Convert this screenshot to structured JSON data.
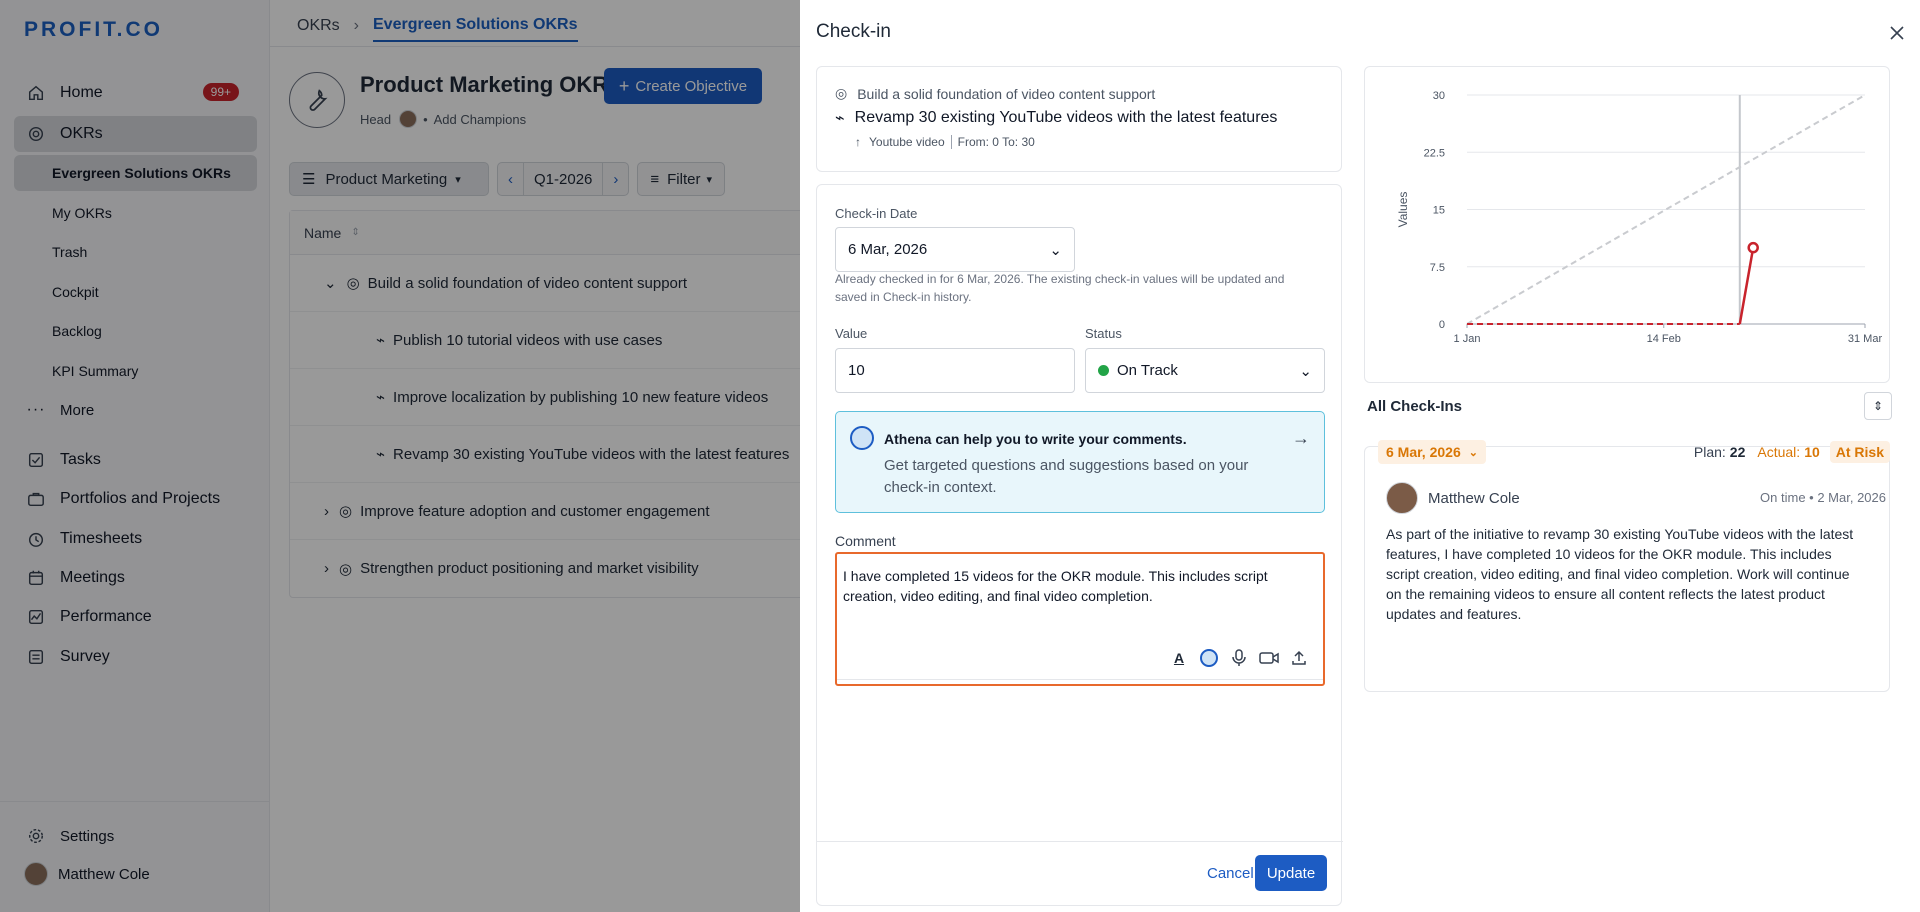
{
  "sidebar": {
    "logo": "PROFIT.CO",
    "nav": [
      {
        "label": "Home",
        "badge": "99+"
      },
      {
        "label": "OKRs"
      }
    ],
    "sub": [
      "Evergreen Solutions OKRs",
      "My OKRs",
      "Trash",
      "Cockpit",
      "Backlog",
      "KPI Summary"
    ],
    "more": "More",
    "nav2": [
      "Tasks",
      "Portfolios and Projects",
      "Timesheets",
      "Meetings",
      "Performance",
      "Survey"
    ],
    "settings": "Settings",
    "user": "Matthew Cole"
  },
  "main": {
    "breadcrumb": [
      "OKRs",
      "Evergreen Solutions OKRs"
    ],
    "title": "Product Marketing OKRs",
    "create_btn": "Create Objective",
    "head_label": "Head",
    "add_champions": "Add Champions",
    "toolbar": {
      "team": "Product Marketing",
      "period": "Q1-2026",
      "filter": "Filter"
    },
    "table_header": "Name",
    "rows": [
      "Build a solid foundation of video content support",
      "Publish 10 tutorial videos with use cases",
      "Improve localization by publishing 10 new feature videos",
      "Revamp 30 existing YouTube videos with the latest features",
      "Improve feature adoption and customer engagement",
      "Strengthen product positioning and market visibility"
    ]
  },
  "panel": {
    "title": "Check-in",
    "objective": "Build a solid foundation of video content support",
    "key_result": "Revamp 30 existing YouTube videos with the latest features",
    "metric": "Youtube video",
    "from_to": "From: 0 To: 30",
    "checkin_date_label": "Check-in Date",
    "checkin_date": "6 Mar, 2026",
    "hint": "Already checked in for 6 Mar, 2026. The existing check-in values will be updated and saved in Check-in history.",
    "value_label": "Value",
    "value": "10",
    "status_label": "Status",
    "status": "On Track",
    "athena_title": "Athena can help you to write your comments.",
    "athena_sub": "Get targeted questions and suggestions based on your check-in context.",
    "comment_label": "Comment",
    "comment": "I have completed 15 videos for the OKR module. This includes script creation, video editing, and final video completion.",
    "cancel": "Cancel",
    "update": "Update"
  },
  "chart_data": {
    "type": "line",
    "ylabel": "Values",
    "y_ticks": [
      "30",
      "22.5",
      "15",
      "7.5",
      "0"
    ],
    "x_ticks": [
      "1 Jan",
      "14 Feb",
      "31 Mar"
    ],
    "ylim": [
      0,
      30
    ],
    "series": [
      {
        "style": "dashed-gray",
        "x": [
          "1 Jan",
          "31 Mar"
        ],
        "values": [
          0,
          30
        ]
      },
      {
        "style": "solid-red",
        "x": [
          "1 Jan",
          "3 Mar",
          "6 Mar"
        ],
        "values": [
          0,
          0,
          10
        ]
      }
    ],
    "marker": {
      "x": "6 Mar",
      "value": 10
    },
    "today_line": "3 Mar"
  },
  "checkins": {
    "title": "All Check-Ins",
    "date": "6 Mar, 2026",
    "plan_label": "Plan:",
    "plan_value": "22",
    "actual_label": "Actual:",
    "actual_value": "10",
    "status": "At Risk",
    "user": "Matthew Cole",
    "time": "On time • 2 Mar, 2026",
    "text": "As part of the initiative to revamp 30 existing YouTube videos with the latest features, I have completed 10 videos for the OKR module. This includes script creation, video editing, and final video completion. Work will continue on the remaining videos to ensure all content reflects the latest product updates and features."
  }
}
